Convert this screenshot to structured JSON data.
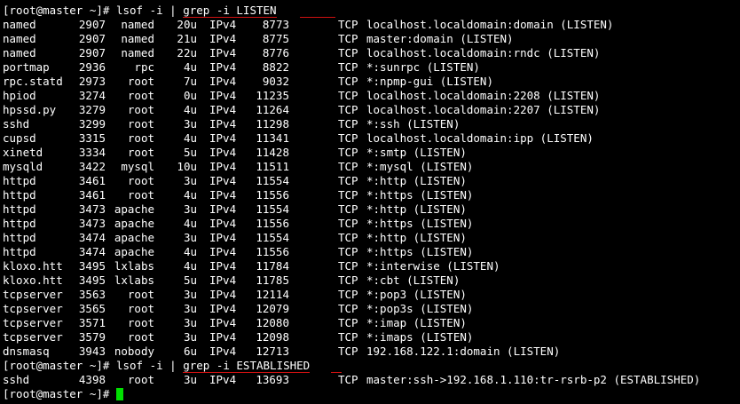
{
  "terminal": {
    "prompt1": {
      "prompt": "[root@master ~]# ",
      "cmd_a": "lsof -i | ",
      "cmd_b": "grep -i LISTEN"
    },
    "listen_rows": [
      [
        "named",
        "2907",
        "named",
        "20u",
        "IPv4",
        "8773",
        "TCP",
        "localhost.localdomain:domain (LISTEN)"
      ],
      [
        "named",
        "2907",
        "named",
        "21u",
        "IPv4",
        "8775",
        "TCP",
        "master:domain (LISTEN)"
      ],
      [
        "named",
        "2907",
        "named",
        "22u",
        "IPv4",
        "8776",
        "TCP",
        "localhost.localdomain:rndc (LISTEN)"
      ],
      [
        "portmap",
        "2936",
        "rpc",
        "4u",
        "IPv4",
        "8822",
        "TCP",
        "*:sunrpc (LISTEN)"
      ],
      [
        "rpc.statd",
        "2973",
        "root",
        "7u",
        "IPv4",
        "9032",
        "TCP",
        "*:npmp-gui (LISTEN)"
      ],
      [
        "hpiod",
        "3274",
        "root",
        "0u",
        "IPv4",
        "11235",
        "TCP",
        "localhost.localdomain:2208 (LISTEN)"
      ],
      [
        "hpssd.py",
        "3279",
        "root",
        "4u",
        "IPv4",
        "11264",
        "TCP",
        "localhost.localdomain:2207 (LISTEN)"
      ],
      [
        "sshd",
        "3299",
        "root",
        "3u",
        "IPv4",
        "11298",
        "TCP",
        "*:ssh (LISTEN)"
      ],
      [
        "cupsd",
        "3315",
        "root",
        "4u",
        "IPv4",
        "11341",
        "TCP",
        "localhost.localdomain:ipp (LISTEN)"
      ],
      [
        "xinetd",
        "3334",
        "root",
        "5u",
        "IPv4",
        "11428",
        "TCP",
        "*:smtp (LISTEN)"
      ],
      [
        "mysqld",
        "3422",
        "mysql",
        "10u",
        "IPv4",
        "11511",
        "TCP",
        "*:mysql (LISTEN)"
      ],
      [
        "httpd",
        "3461",
        "root",
        "3u",
        "IPv4",
        "11554",
        "TCP",
        "*:http (LISTEN)"
      ],
      [
        "httpd",
        "3461",
        "root",
        "4u",
        "IPv4",
        "11556",
        "TCP",
        "*:https (LISTEN)"
      ],
      [
        "httpd",
        "3473",
        "apache",
        "3u",
        "IPv4",
        "11554",
        "TCP",
        "*:http (LISTEN)"
      ],
      [
        "httpd",
        "3473",
        "apache",
        "4u",
        "IPv4",
        "11556",
        "TCP",
        "*:https (LISTEN)"
      ],
      [
        "httpd",
        "3474",
        "apache",
        "3u",
        "IPv4",
        "11554",
        "TCP",
        "*:http (LISTEN)"
      ],
      [
        "httpd",
        "3474",
        "apache",
        "4u",
        "IPv4",
        "11556",
        "TCP",
        "*:https (LISTEN)"
      ],
      [
        "kloxo.htt",
        "3495",
        "lxlabs",
        "4u",
        "IPv4",
        "11784",
        "TCP",
        "*:interwise (LISTEN)"
      ],
      [
        "kloxo.htt",
        "3495",
        "lxlabs",
        "5u",
        "IPv4",
        "11785",
        "TCP",
        "*:cbt (LISTEN)"
      ],
      [
        "tcpserver",
        "3563",
        "root",
        "3u",
        "IPv4",
        "12114",
        "TCP",
        "*:pop3 (LISTEN)"
      ],
      [
        "tcpserver",
        "3565",
        "root",
        "3u",
        "IPv4",
        "12079",
        "TCP",
        "*:pop3s (LISTEN)"
      ],
      [
        "tcpserver",
        "3571",
        "root",
        "3u",
        "IPv4",
        "12080",
        "TCP",
        "*:imap (LISTEN)"
      ],
      [
        "tcpserver",
        "3579",
        "root",
        "3u",
        "IPv4",
        "12098",
        "TCP",
        "*:imaps (LISTEN)"
      ],
      [
        "dnsmasq",
        "3943",
        "nobody",
        "6u",
        "IPv4",
        "12713",
        "TCP",
        "192.168.122.1:domain (LISTEN)"
      ]
    ],
    "prompt2": {
      "prompt": "[root@master ~]# ",
      "cmd_a": "lsof -i | ",
      "cmd_b": "grep -i ESTABLISHED"
    },
    "established_rows": [
      [
        "sshd",
        "4398",
        "root",
        "3u",
        "IPv4",
        "13693",
        "TCP",
        "master:ssh->192.168.1.110:tr-rsrb-p2 (ESTABLISHED)"
      ]
    ],
    "prompt3": {
      "prompt": "[root@master ~]# "
    },
    "colors": {
      "background": "#000000",
      "text": "#ffffff",
      "underline": "#d01010",
      "cursor": "#00e000"
    }
  }
}
